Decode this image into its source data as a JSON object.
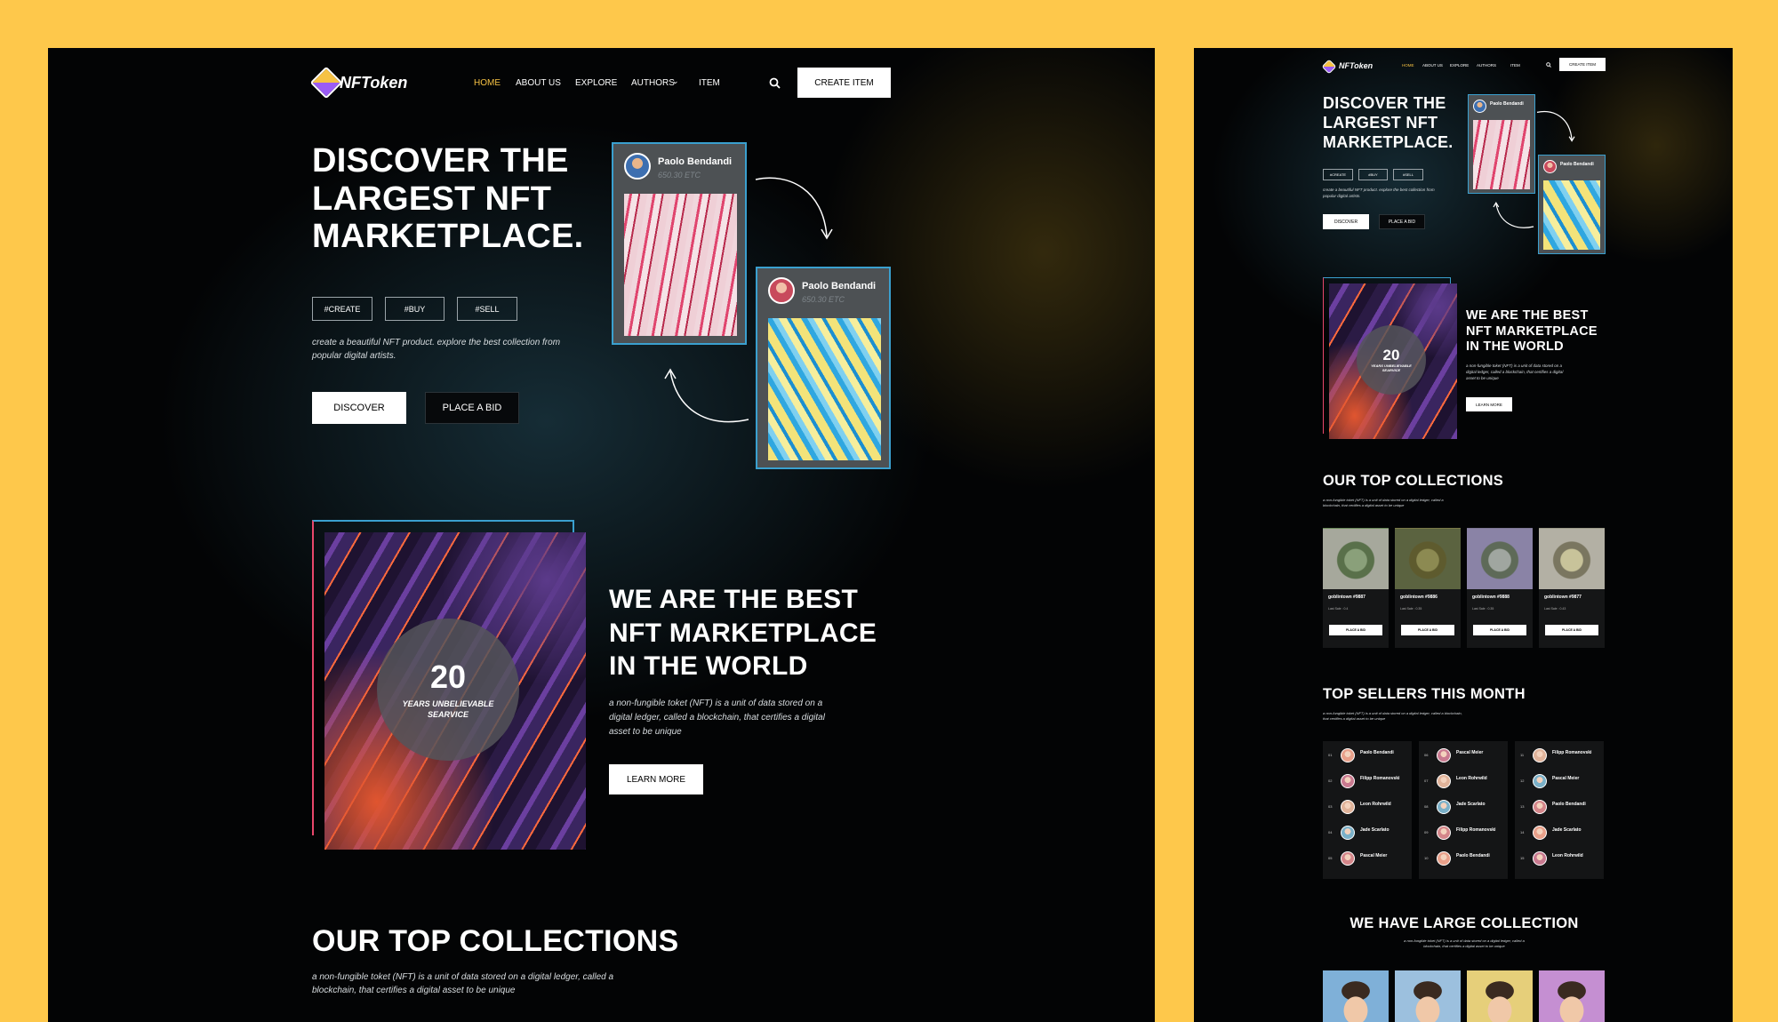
{
  "brand": {
    "name": "NFToken"
  },
  "nav": {
    "home": "HOME",
    "about": "ABOUT US",
    "explore": "EXPLORE",
    "authors": "AUTHORS",
    "item": "ITEM",
    "create": "CREATE ITEM"
  },
  "hero": {
    "title_line1": "DISCOVER THE",
    "title_line2": "LARGEST NFT",
    "title_line3": "MARKETPLACE.",
    "tags": [
      "#CREATE",
      "#BUY",
      "#SELL"
    ],
    "desc_line1": "create a beautiful NFT product. explore the best collection from",
    "desc_line2": "popular digital artists.",
    "discover": "DISCOVER",
    "bid": "PLACE A BID",
    "cards": [
      {
        "name": "Paolo Bendandi",
        "price": "650.30 ETC"
      },
      {
        "name": "Paolo Bendandi",
        "price": "650.30 ETC"
      }
    ]
  },
  "about": {
    "years": "20",
    "years_line1": "YEARS UNBELIEVABLE",
    "years_line2": "SEARVICE",
    "title_line1": "WE ARE THE BEST",
    "title_line2": "NFT MARKETPLACE",
    "title_line3": "IN THE WORLD",
    "desc_line1": "a non-fungible toket (NFT) is a unit of data stored on a",
    "desc_line2": "digital ledger, called a blockchain, that certifies a digital",
    "desc_line3": "asset to be unique",
    "learn": "LEARN MORE"
  },
  "collections": {
    "title": "OUR TOP COLLECTIONS",
    "desc_line1": "a non-fungible toket (NFT) is a unit of data stored on a digital ledger, called a",
    "desc_line2": "blockchain, that certifies a digital asset to be unique",
    "items": [
      {
        "name": "goblintown #9887",
        "meta": "Last Sale : 0.4",
        "bid": "PLACE A BID",
        "color": "#6b8a5a"
      },
      {
        "name": "goblintown #9886",
        "meta": "Last Sale : 0.35",
        "bid": "PLACE A BID",
        "color": "#7a7a48"
      },
      {
        "name": "goblintown #9888",
        "meta": "Last Sale : 0.35",
        "bid": "PLACE A BID",
        "color": "#7d7794"
      },
      {
        "name": "goblintown #9877",
        "meta": "Last Sale : 0.43",
        "bid": "PLACE A BID",
        "color": "#9a9a88"
      }
    ]
  },
  "sellers": {
    "title": "TOP SELLERS THIS MONTH",
    "desc_line1": "a non-fungible toket (NFT) is a unit of data stored on a digital ledger, called a blockchain,",
    "desc_line2": "that certifies a digital asset to be unique",
    "columns": [
      [
        {
          "num": "01",
          "name": "Paolo Bendandi"
        },
        {
          "num": "02",
          "name": "Filipp Romanovski"
        },
        {
          "num": "03",
          "name": "Leon Rohrwild"
        },
        {
          "num": "04",
          "name": "Jade Scarlato"
        },
        {
          "num": "05",
          "name": "Pascal Meier"
        }
      ],
      [
        {
          "num": "06",
          "name": "Pascal Meier"
        },
        {
          "num": "07",
          "name": "Leon Rohrwild"
        },
        {
          "num": "08",
          "name": "Jade Scarlato"
        },
        {
          "num": "09",
          "name": "Filipp Romanovski"
        },
        {
          "num": "10",
          "name": "Paolo Bendandi"
        }
      ],
      [
        {
          "num": "11",
          "name": "Filipp Romanovski"
        },
        {
          "num": "12",
          "name": "Pascal Meier"
        },
        {
          "num": "13",
          "name": "Paolo Bendandi"
        },
        {
          "num": "14",
          "name": "Jade Scarlato"
        },
        {
          "num": "15",
          "name": "Leon Rohrwild"
        }
      ]
    ]
  },
  "large": {
    "title": "WE HAVE LARGE COLLECTION",
    "desc_line1": "a non-fungible toket (NFT) is a unit of data stored on a digital ledger, called a",
    "desc_line2": "blockchain, that certifies a digital asset to be unique",
    "colors": [
      "#7fb0d8",
      "#9cc0de",
      "#e6cf7a",
      "#c58fd2"
    ]
  },
  "colors": {
    "background": "#fec84b",
    "accent": "#f6c244",
    "frame": "#3aa0cf"
  }
}
